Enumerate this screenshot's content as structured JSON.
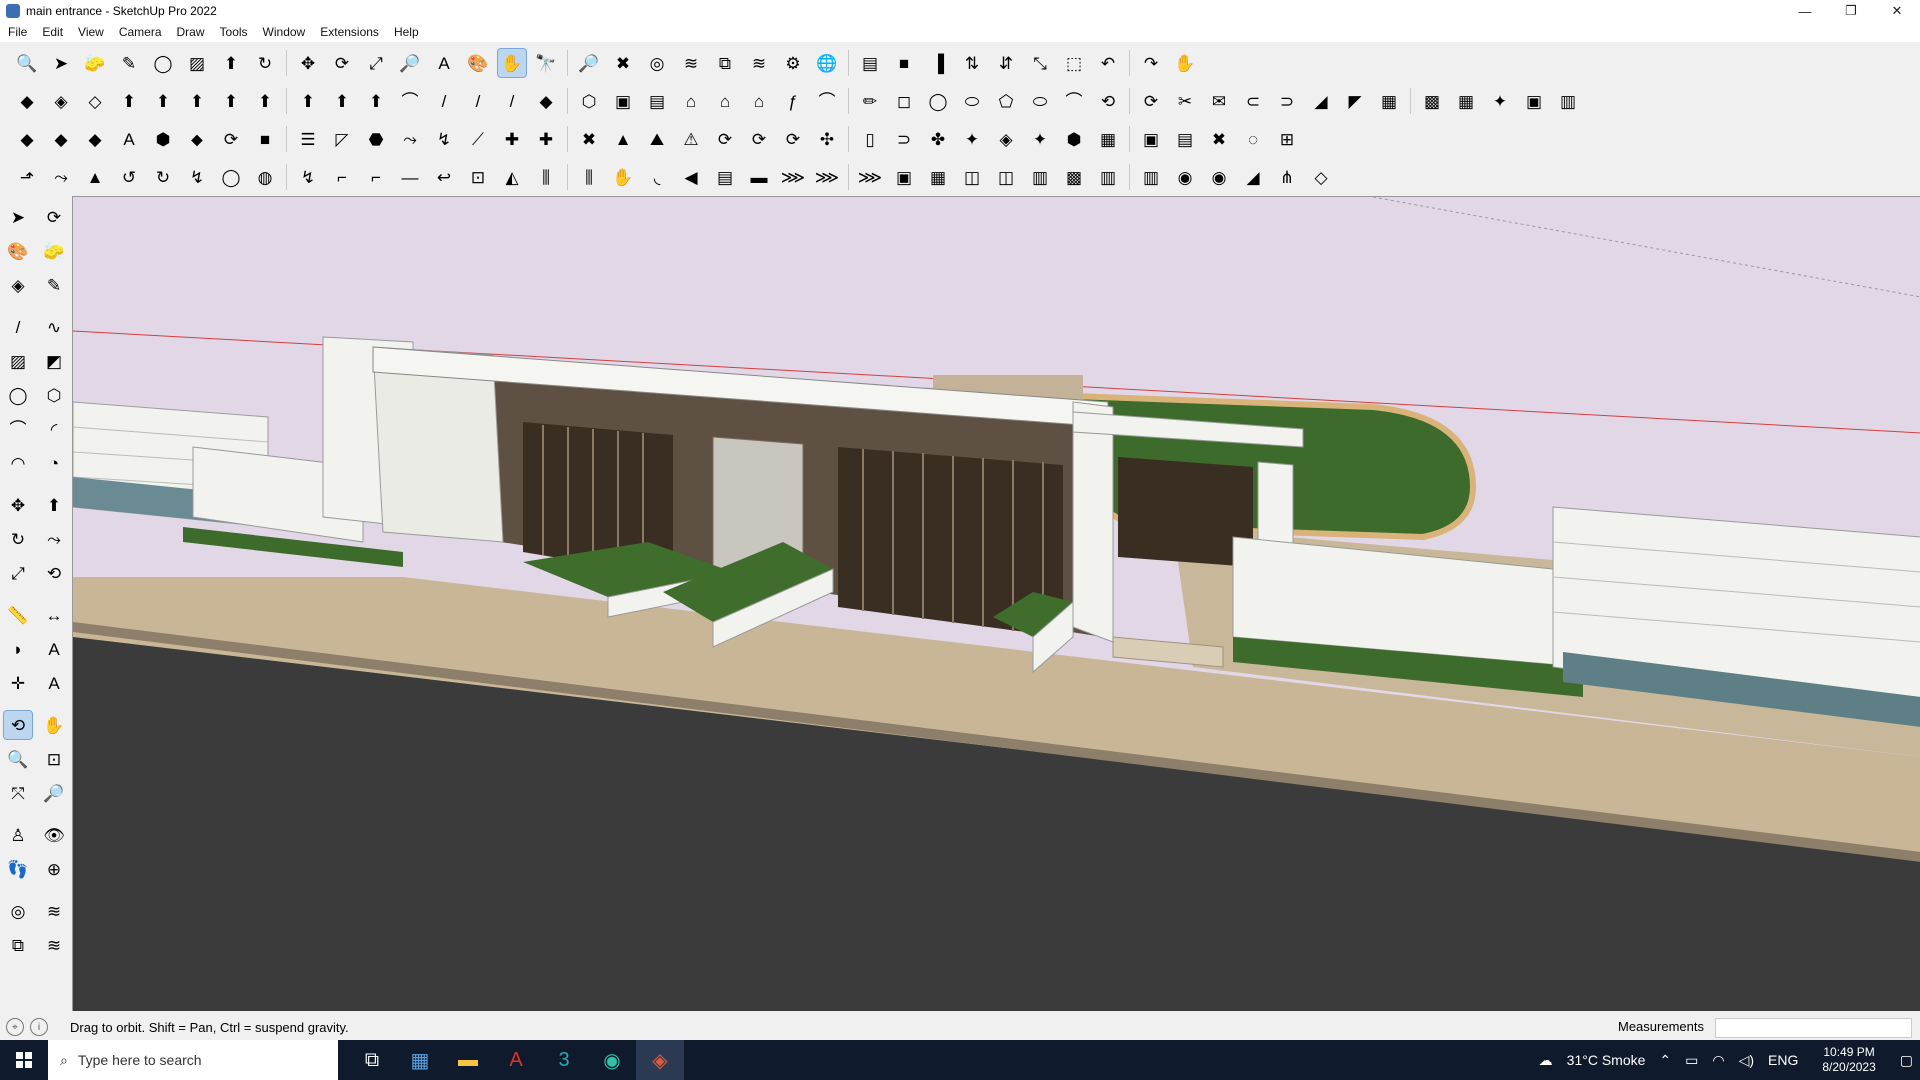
{
  "window": {
    "title": "main entrance - SketchUp Pro 2022",
    "minimize": "—",
    "maximize": "❐",
    "close": "✕"
  },
  "menu": [
    "File",
    "Edit",
    "View",
    "Camera",
    "Draw",
    "Tools",
    "Window",
    "Extensions",
    "Help"
  ],
  "toolbar": {
    "row1": [
      "🔍",
      "➤",
      "🧽",
      "✎",
      "◯",
      "▨",
      "⬆",
      "↻",
      "✥",
      "⟳",
      "⤢",
      "🔎",
      "A",
      "🎨",
      "✋",
      "🔭",
      "🔎",
      "✖",
      "◎",
      "≋",
      "⧉",
      "≋",
      "⚙",
      "🌐",
      "▤",
      "■",
      "▐",
      "⇅",
      "⇵",
      "⤡",
      "⬚",
      "↶",
      "↷",
      "✋"
    ],
    "row2": [
      "◆",
      "◈",
      "◇",
      "⬆",
      "⬆",
      "⬆",
      "⬆",
      "⬆",
      "⬆",
      "⬆",
      "⬆",
      "⌒",
      "/",
      "/",
      "/",
      "◆",
      "⬡",
      "▣",
      "▤",
      "⌂",
      "⌂",
      "⌂",
      "ƒ",
      "⌒",
      "✏",
      "◻",
      "◯",
      "⬭",
      "⬠",
      "⬭",
      "⌒",
      "⟲",
      "⟳",
      "✂",
      "✉",
      "⊂",
      "⊃",
      "◢",
      "◤",
      "▦",
      "▩",
      "▦",
      "✦",
      "▣",
      "▥"
    ],
    "row3": [
      "◆",
      "◆",
      "◆",
      "A",
      "⬢",
      "⬥",
      "⟳",
      "■",
      "☰",
      "◸",
      "⬣",
      "⤳",
      "↯",
      "⟋",
      "✚",
      "✚",
      "✖",
      "▲",
      "⛰",
      "⚠",
      "⟳",
      "⟳",
      "⟳",
      "✣",
      "▯",
      "⊃",
      "✤",
      "✦",
      "◈",
      "✦",
      "⬢",
      "▦",
      "▣",
      "▤",
      "✖",
      "◌",
      "⊞"
    ],
    "row4": [
      "⬏",
      "⤳",
      "▲",
      "↺",
      "↻",
      "↯",
      "◯",
      "◍",
      "↯",
      "⌐",
      "⌐",
      "—",
      "↩",
      "⊡",
      "◭",
      "⫼",
      "⫼",
      "✋",
      "◟",
      "◀",
      "▤",
      "▬",
      "⋙",
      "⋙",
      "⋙",
      "▣",
      "▦",
      "◫",
      "◫",
      "▥",
      "▩",
      "▥",
      "▥",
      "◉",
      "◉",
      "◢",
      "⋔",
      "◇"
    ]
  },
  "status": {
    "hint": "Drag to orbit. Shift = Pan, Ctrl = suspend gravity.",
    "measurements_label": "Measurements",
    "measurements_value": ""
  },
  "taskbar": {
    "search_placeholder": "Type here to search",
    "weather": "31°C  Smoke",
    "lang": "ENG",
    "time": "10:49 PM",
    "date": "8/20/2023"
  },
  "colors": {
    "sky": "#e2d7e6",
    "ground": "#3c3c3c",
    "paving": "#c9b79a",
    "stone": "#f2f2ef",
    "greenery": "#3d6b2b",
    "window": "#3a2e22"
  }
}
